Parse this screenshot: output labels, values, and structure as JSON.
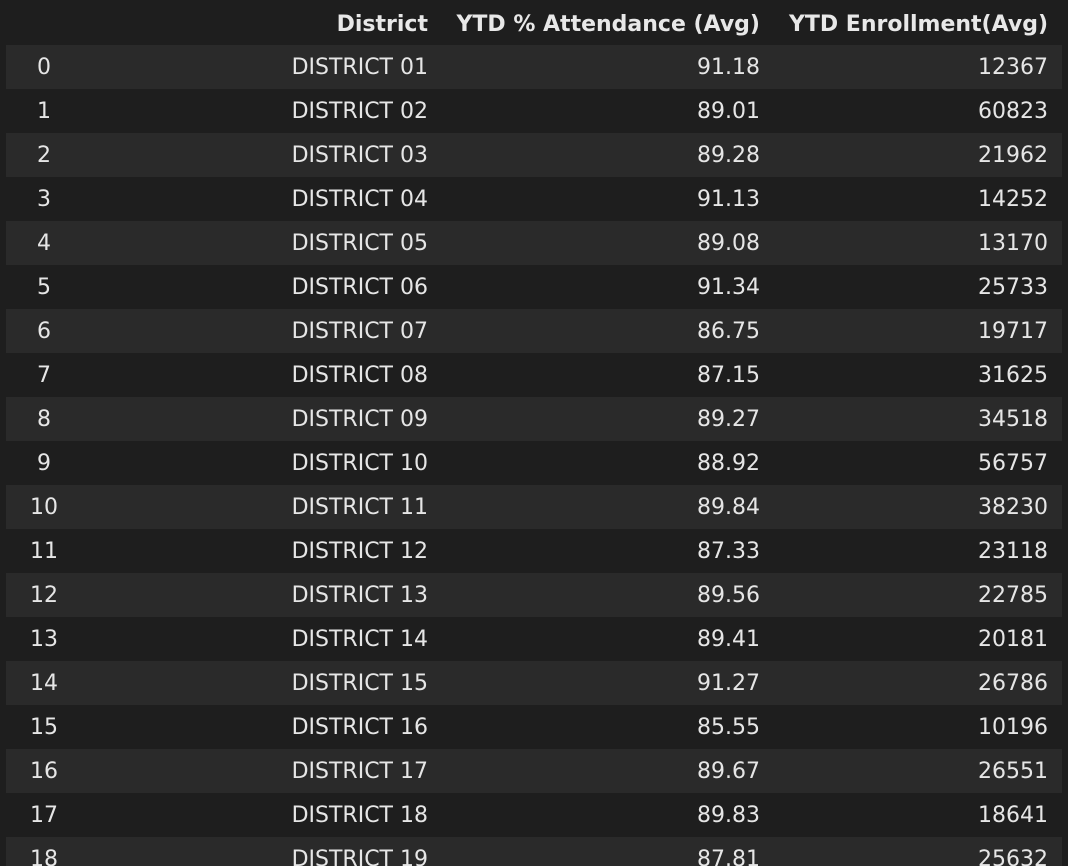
{
  "table": {
    "columns": [
      "",
      "District",
      "YTD % Attendance (Avg)",
      "YTD Enrollment(Avg)"
    ],
    "rows": [
      {
        "index": "0",
        "district": "DISTRICT 01",
        "attendance": "91.18",
        "enrollment": "12367"
      },
      {
        "index": "1",
        "district": "DISTRICT 02",
        "attendance": "89.01",
        "enrollment": "60823"
      },
      {
        "index": "2",
        "district": "DISTRICT 03",
        "attendance": "89.28",
        "enrollment": "21962"
      },
      {
        "index": "3",
        "district": "DISTRICT 04",
        "attendance": "91.13",
        "enrollment": "14252"
      },
      {
        "index": "4",
        "district": "DISTRICT 05",
        "attendance": "89.08",
        "enrollment": "13170"
      },
      {
        "index": "5",
        "district": "DISTRICT 06",
        "attendance": "91.34",
        "enrollment": "25733"
      },
      {
        "index": "6",
        "district": "DISTRICT 07",
        "attendance": "86.75",
        "enrollment": "19717"
      },
      {
        "index": "7",
        "district": "DISTRICT 08",
        "attendance": "87.15",
        "enrollment": "31625"
      },
      {
        "index": "8",
        "district": "DISTRICT 09",
        "attendance": "89.27",
        "enrollment": "34518"
      },
      {
        "index": "9",
        "district": "DISTRICT 10",
        "attendance": "88.92",
        "enrollment": "56757"
      },
      {
        "index": "10",
        "district": "DISTRICT 11",
        "attendance": "89.84",
        "enrollment": "38230"
      },
      {
        "index": "11",
        "district": "DISTRICT 12",
        "attendance": "87.33",
        "enrollment": "23118"
      },
      {
        "index": "12",
        "district": "DISTRICT 13",
        "attendance": "89.56",
        "enrollment": "22785"
      },
      {
        "index": "13",
        "district": "DISTRICT 14",
        "attendance": "89.41",
        "enrollment": "20181"
      },
      {
        "index": "14",
        "district": "DISTRICT 15",
        "attendance": "91.27",
        "enrollment": "26786"
      },
      {
        "index": "15",
        "district": "DISTRICT 16",
        "attendance": "85.55",
        "enrollment": "10196"
      },
      {
        "index": "16",
        "district": "DISTRICT 17",
        "attendance": "89.67",
        "enrollment": "26551"
      },
      {
        "index": "17",
        "district": "DISTRICT 18",
        "attendance": "89.83",
        "enrollment": "18641"
      },
      {
        "index": "18",
        "district": "DISTRICT 19",
        "attendance": "87.81",
        "enrollment": "25632"
      }
    ]
  }
}
